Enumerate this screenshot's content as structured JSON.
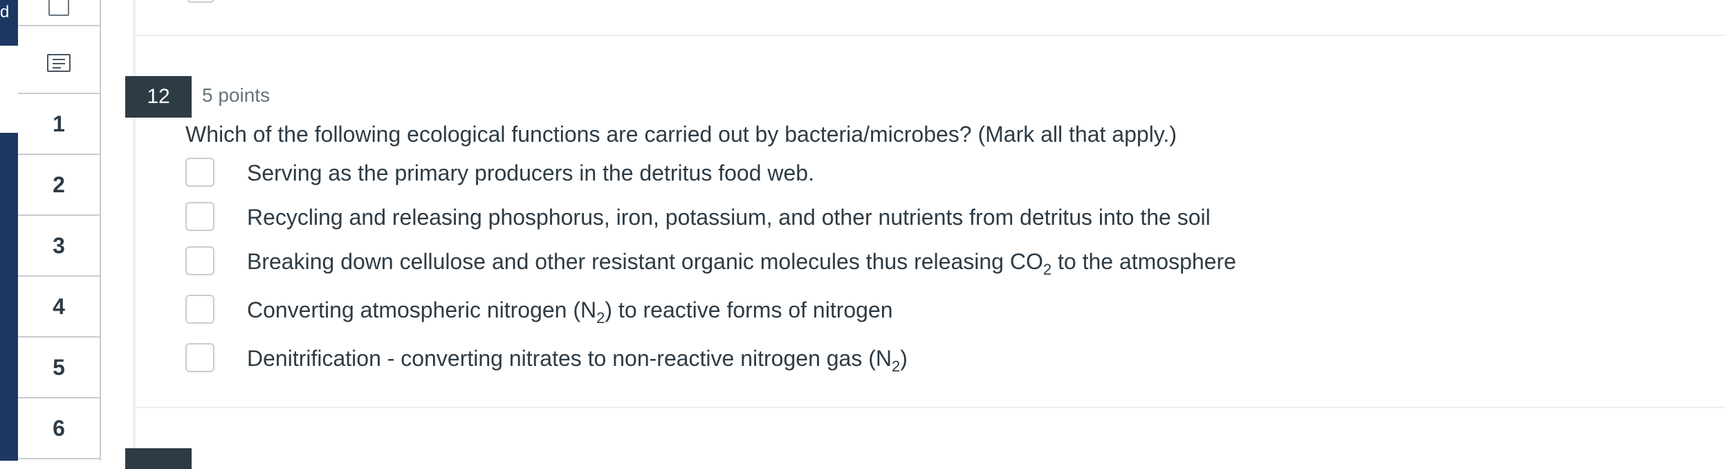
{
  "nav_strip": {
    "glyph": "d"
  },
  "question_nav": {
    "items": [
      "1",
      "2",
      "3",
      "4",
      "5",
      "6"
    ]
  },
  "question": {
    "number": "12",
    "points": "5 points",
    "text": "Which of the following ecological functions are carried out by bacteria/microbes? (Mark all that apply.)",
    "answers": [
      {
        "pre": "Serving as the primary producers in the detritus food web.",
        "sub": "",
        "post": ""
      },
      {
        "pre": "Recycling and releasing phosphorus, iron, potassium, and other nutrients from detritus into the soil",
        "sub": "",
        "post": ""
      },
      {
        "pre": "Breaking down cellulose and other resistant organic molecules thus releasing CO",
        "sub": "2",
        "post": " to the atmosphere"
      },
      {
        "pre": "Converting atmospheric nitrogen (N",
        "sub": "2",
        "post": ") to reactive forms of nitrogen"
      },
      {
        "pre": "Denitrification - converting nitrates to non-reactive nitrogen gas (N",
        "sub": "2",
        "post": ")"
      }
    ]
  },
  "colors": {
    "nav_dark": "#1c3762",
    "badge": "#2d3b45",
    "text": "#2d3b45",
    "muted": "#66727a",
    "border": "#c7cdd1"
  },
  "icons": [
    "flag-checkbox-icon",
    "text-question-icon"
  ]
}
